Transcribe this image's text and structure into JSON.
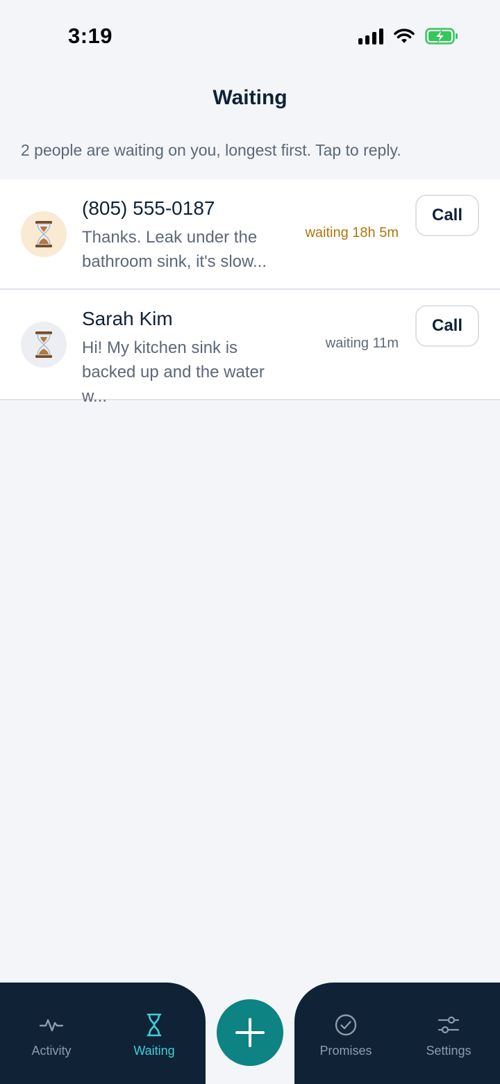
{
  "status_bar": {
    "time": "3:19"
  },
  "header": {
    "title": "Waiting",
    "subtitle": "2 people are waiting on you, longest first. Tap to reply."
  },
  "conversations": [
    {
      "name": "(805) 555-0187",
      "message": "Thanks. Leak under the bathroom sink, it's slow...",
      "waiting": "waiting 18h 5m",
      "call_label": "Call",
      "avatar_icon": "hourglass-icon"
    },
    {
      "name": "Sarah Kim",
      "message": "Hi! My kitchen sink is backed up and the water w...",
      "waiting": "waiting 11m",
      "call_label": "Call",
      "avatar_icon": "hourglass-icon"
    }
  ],
  "tabbar": {
    "tabs": [
      {
        "label": "Activity",
        "icon": "pulse-icon",
        "active": false
      },
      {
        "label": "Waiting",
        "icon": "hourglass-icon",
        "active": true
      },
      {
        "label": "Promises",
        "icon": "check-circle-icon",
        "active": false
      },
      {
        "label": "Settings",
        "icon": "sliders-icon",
        "active": false
      }
    ],
    "fab_icon": "plus-icon"
  },
  "colors": {
    "navy": "#0f2236",
    "teal_fab": "#0e8383",
    "active_tab": "#3dd0d8",
    "inactive_tab": "#8e9bad",
    "waiting_late": "#b07608",
    "battery": "#34c759"
  }
}
